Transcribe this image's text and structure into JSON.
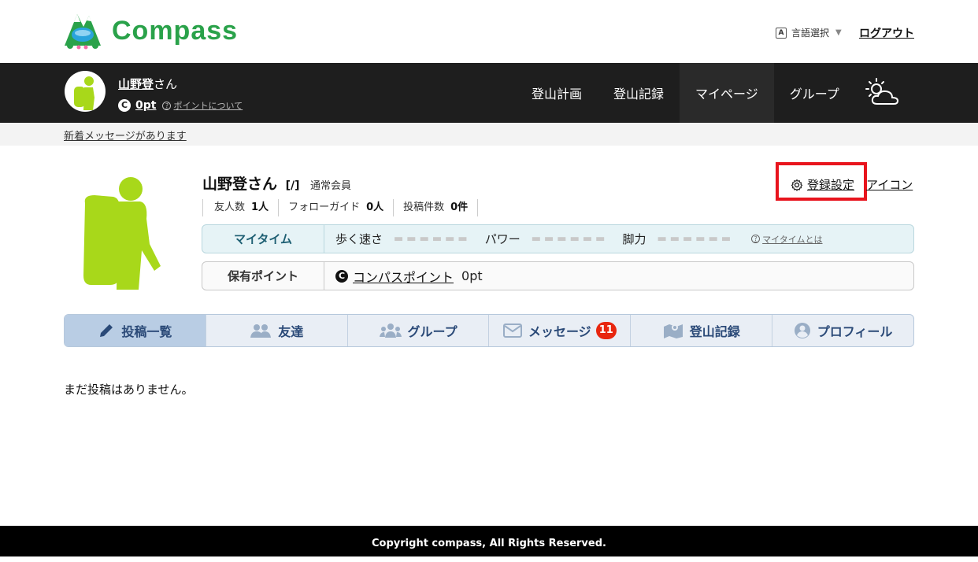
{
  "header": {
    "logo_text": "Compass",
    "language_label": "言語選択",
    "language_icon_letter": "A",
    "logout_label": "ログアウト"
  },
  "navbar": {
    "user_name": "山野登",
    "honorific": "さん",
    "coin_symbol": "C",
    "points": "0pt",
    "points_help": "ポイントについて",
    "links": [
      "登山計画",
      "登山記録",
      "マイページ",
      "グループ"
    ],
    "active_link": "マイページ"
  },
  "notice": {
    "text": "新着メッセージがあります"
  },
  "profile": {
    "name": "山野登さん",
    "tag": "[/]",
    "member_type": "通常会員",
    "stats": [
      {
        "label": "友人数",
        "value": "1人"
      },
      {
        "label": "フォローガイド",
        "value": "0人"
      },
      {
        "label": "投稿件数",
        "value": "0件"
      }
    ],
    "settings_label": "登録設定",
    "icon_label": "アイコン",
    "mytime": {
      "label": "マイタイム",
      "metrics": [
        "歩く速さ",
        "パワー",
        "脚力"
      ],
      "help": "マイタイムとは"
    },
    "points_row": {
      "label": "保有ポイント",
      "coin_symbol": "C",
      "link": "コンパスポイント",
      "value": "0pt"
    }
  },
  "tabs": [
    {
      "label": "投稿一覧",
      "icon": "pencil-icon",
      "active": true
    },
    {
      "label": "友達",
      "icon": "users-icon"
    },
    {
      "label": "グループ",
      "icon": "group-icon"
    },
    {
      "label": "メッセージ",
      "icon": "envelope-icon",
      "badge": "11"
    },
    {
      "label": "登山記録",
      "icon": "map-icon"
    },
    {
      "label": "プロフィール",
      "icon": "user-circle-icon"
    }
  ],
  "empty_message": "まだ投稿はありません。",
  "footer": {
    "copyright": "Copyright compass, All Rights Reserved."
  },
  "colors": {
    "brand_green": "#2aa24a",
    "avatar_green": "#a8d81a",
    "nav_dark": "#1e1e1e",
    "highlight_red": "#e8141d",
    "tab_text": "#2b4a78",
    "badge_red": "#e8260f"
  }
}
